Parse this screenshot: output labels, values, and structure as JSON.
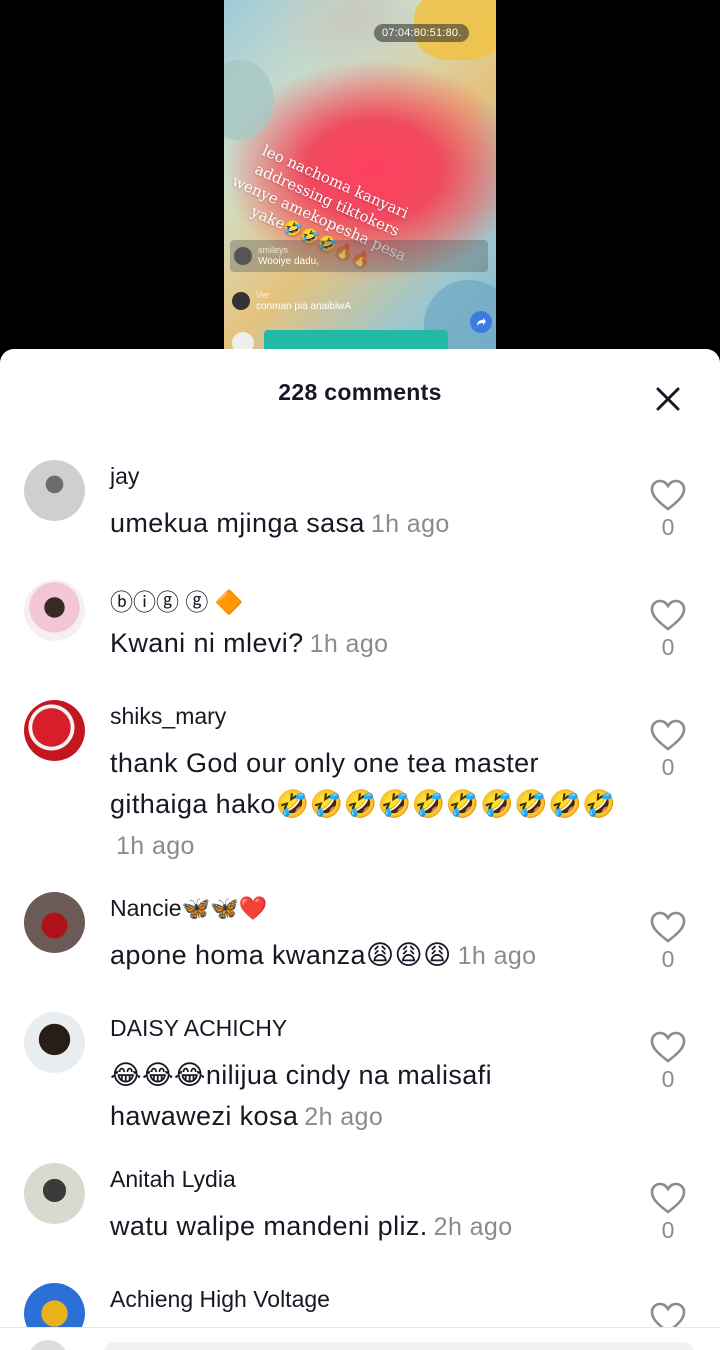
{
  "video": {
    "timestamp": "07:04:80:51:80.",
    "caption": "leo nachoma kanyari addressing tiktokers wenye amekopesha pesa yake🤣🤣🤣🔥🔥",
    "live_comments": [
      {
        "user": "smileys",
        "text": "Wooiye dadu,"
      },
      {
        "user": "Ver",
        "text": "conman pia anaibiwA"
      }
    ]
  },
  "sheet": {
    "title": "228 comments"
  },
  "comments": [
    {
      "user": "jay",
      "text": "umekua mjinga sasa",
      "time": "1h ago",
      "likes": "0"
    },
    {
      "user": "ⓑⓘⓖ ⓖ 🔶",
      "text": "Kwani ni mlevi?",
      "time": "1h ago",
      "likes": "0"
    },
    {
      "user": "shiks_mary",
      "text": "thank God our only one tea master githaiga hako🤣🤣🤣🤣🤣🤣🤣🤣🤣🤣",
      "time": "1h ago",
      "likes": "0"
    },
    {
      "user": "Nancie🦋🦋❤️",
      "text": "apone homa kwanza😩😩😩",
      "time": "1h ago",
      "likes": "0"
    },
    {
      "user": "DAISY ACHICHY",
      "text": "😂😂😂nilijua cindy na malisafi hawawezi kosa",
      "time": "2h ago",
      "likes": "0"
    },
    {
      "user": "Anitah Lydia",
      "text": "watu walipe mandeni pliz.",
      "time": "2h ago",
      "likes": "0"
    },
    {
      "user": "Achieng High Voltage",
      "text": "",
      "time": "",
      "likes": ""
    }
  ],
  "colors": {
    "text_primary": "#161823",
    "text_secondary": "#8a8b91",
    "accent_teal": "#23b9a7"
  }
}
